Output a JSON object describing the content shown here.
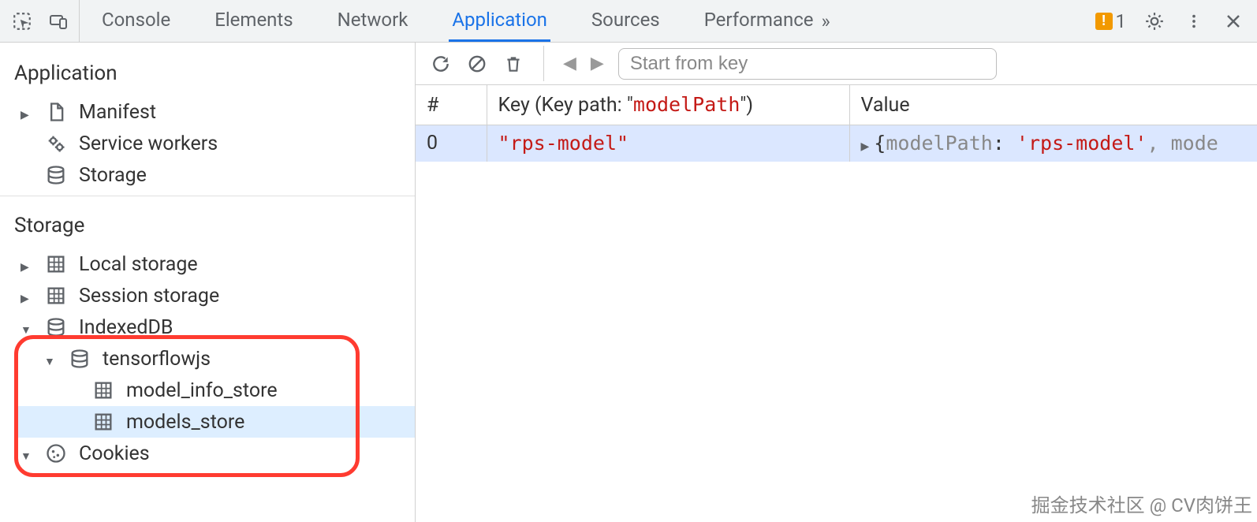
{
  "tabs": {
    "items": [
      "Console",
      "Elements",
      "Network",
      "Application",
      "Sources",
      "Performance"
    ],
    "activeIndex": 3,
    "overflow_glyph": "»"
  },
  "badge": {
    "count": "1"
  },
  "sidebar": {
    "sections": [
      {
        "title": "Application",
        "items": [
          {
            "label": "Manifest",
            "icon": "file",
            "expandable": true,
            "open": false,
            "depth": 0
          },
          {
            "label": "Service workers",
            "icon": "gears",
            "expandable": false,
            "depth": 0
          },
          {
            "label": "Storage",
            "icon": "db",
            "expandable": false,
            "depth": 0
          }
        ]
      },
      {
        "title": "Storage",
        "items": [
          {
            "label": "Local storage",
            "icon": "grid",
            "expandable": true,
            "open": false,
            "depth": 0
          },
          {
            "label": "Session storage",
            "icon": "grid",
            "expandable": true,
            "open": false,
            "depth": 0
          },
          {
            "label": "IndexedDB",
            "icon": "db",
            "expandable": true,
            "open": true,
            "depth": 0
          },
          {
            "label": "tensorflowjs",
            "icon": "db",
            "expandable": true,
            "open": true,
            "depth": 1
          },
          {
            "label": "model_info_store",
            "icon": "grid",
            "expandable": false,
            "depth": 2
          },
          {
            "label": "models_store",
            "icon": "grid",
            "expandable": false,
            "depth": 2,
            "selected": true
          },
          {
            "label": "Cookies",
            "icon": "cookie",
            "expandable": true,
            "open": true,
            "depth": 0
          }
        ]
      }
    ]
  },
  "toolbar": {
    "search_placeholder": "Start from key"
  },
  "table": {
    "headers": {
      "index": "#",
      "key_prefix": "Key (Key path: \"",
      "key_path": "modelPath",
      "key_suffix": "\")",
      "value": "Value"
    },
    "rows": [
      {
        "index": "0",
        "key": "\"rps-model\"",
        "value_preview": {
          "prop1": "modelPath",
          "val1": "'rps-model'",
          "tail": ", mode"
        }
      }
    ]
  },
  "watermark": "掘金技术社区 @ CV肉饼王"
}
